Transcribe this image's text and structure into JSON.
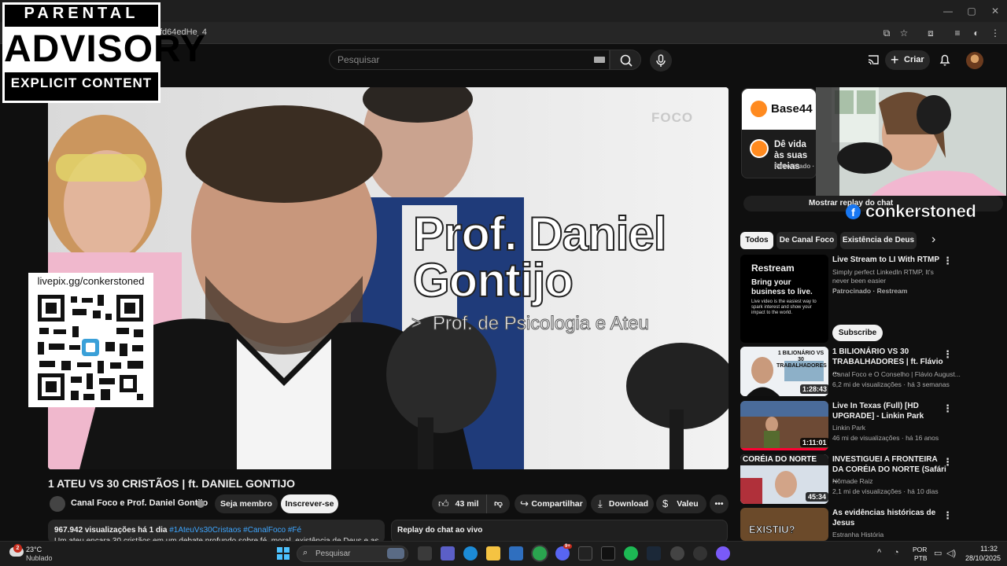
{
  "browser": {
    "url_fragment": "fd64edHe_4",
    "window_controls": [
      "—",
      "▢",
      "✕"
    ]
  },
  "masthead": {
    "search_placeholder": "Pesquisar",
    "create_label": "Criar"
  },
  "overlay": {
    "advisory_line1": "PARENTAL",
    "advisory_line2": "ADVISORY",
    "advisory_line3": "EXPLICIT CONTENT",
    "qr_label": "livepix.gg/conkerstoned",
    "streamer_name": "conkerstoned"
  },
  "video": {
    "frame_title_line1": "Prof. Daniel",
    "frame_title_line2": "Gontijo",
    "frame_subtitle": "Prof. de Psicologia e Ateu",
    "frame_logo": "FOCO",
    "title": "1 ATEU VS 30 CRISTÃOS | ft. DANIEL GONTIJO",
    "channel": "Canal Foco e Prof. Daniel Gontijo",
    "join_label": "Seja membro",
    "subscribe_label": "Inscrever-se",
    "likes": "43 mil",
    "share_label": "Compartilhar",
    "download_label": "Download",
    "thanks_label": "Valeu",
    "views_meta": "967.942 visualizações  há 1 dia",
    "hashtags": " #1AteuVs30Cristaos #CanalFoco #Fé",
    "description_line": "Um ateu encara 30 cristãos em um debate profundo sobre fé, moral, existência de Deus e as",
    "chat_replay_label": "Replay do chat ao vivo"
  },
  "sidebar": {
    "ad": {
      "brand": "Base44",
      "text": "Dê vida às suas ideias",
      "sponsored": "Patrocinado · Base44"
    },
    "chat_button": "Mostrar replay do chat",
    "chips": [
      "Todos",
      "De Canal Foco",
      "Existência de Deus"
    ],
    "items": [
      {
        "title": "Live Stream to LI With RTMP",
        "channel": "Simply perfect LinkedIn RTMP, It's never been easier",
        "meta": "Patrocinado · Restream",
        "thumb_brand": "Restream",
        "thumb_headline": "Bring your business to live.",
        "thumb_small": "Live video is the easiest way to spark interest and show your impact to the world.",
        "cta": "Subscribe"
      },
      {
        "title": "1 BILIONÁRIO VS 30 TRABALHADORES | ft. Flávio ...",
        "channel": "Canal Foco e O Conselho | Flávio August...",
        "meta": "6,2 mi de visualizações · há 3 semanas",
        "duration": "1:28:43",
        "thumb_caption": "1 BILIONÁRIO VS 30 TRABALHADORES"
      },
      {
        "title": "Live In Texas (Full) [HD UPGRADE] - Linkin Park",
        "channel": "Linkin Park",
        "meta": "46 mi de visualizações · há 16 anos",
        "duration": "1:11:01"
      },
      {
        "title": "INVESTIGUEI A FRONTEIRA DA CORÉIA DO NORTE (Safári ...",
        "channel": "Nômade Raiz",
        "meta": "2,1 mi de visualizações · há 10 dias",
        "duration": "45:34",
        "thumb_caption": "CORÉIA DO NORTE"
      },
      {
        "title": "As evidências históricas de Jesus",
        "channel": "Estranha História",
        "meta": "",
        "thumb_caption": "EXISTIU?"
      }
    ]
  },
  "taskbar": {
    "temp": "23°C",
    "weather": "Nublado",
    "search_placeholder": "Pesquisar",
    "lang1": "POR",
    "lang2": "PTB",
    "time": "11:32",
    "date": "28/10/2025",
    "badge_count": "2",
    "discord_badge": "9+"
  },
  "colors": {
    "background": "#0f0f0f",
    "surface": "#272727",
    "accent_link": "#3ea6ff",
    "progress_red": "#ff0033",
    "brand_orange": "#ff8a1f"
  }
}
